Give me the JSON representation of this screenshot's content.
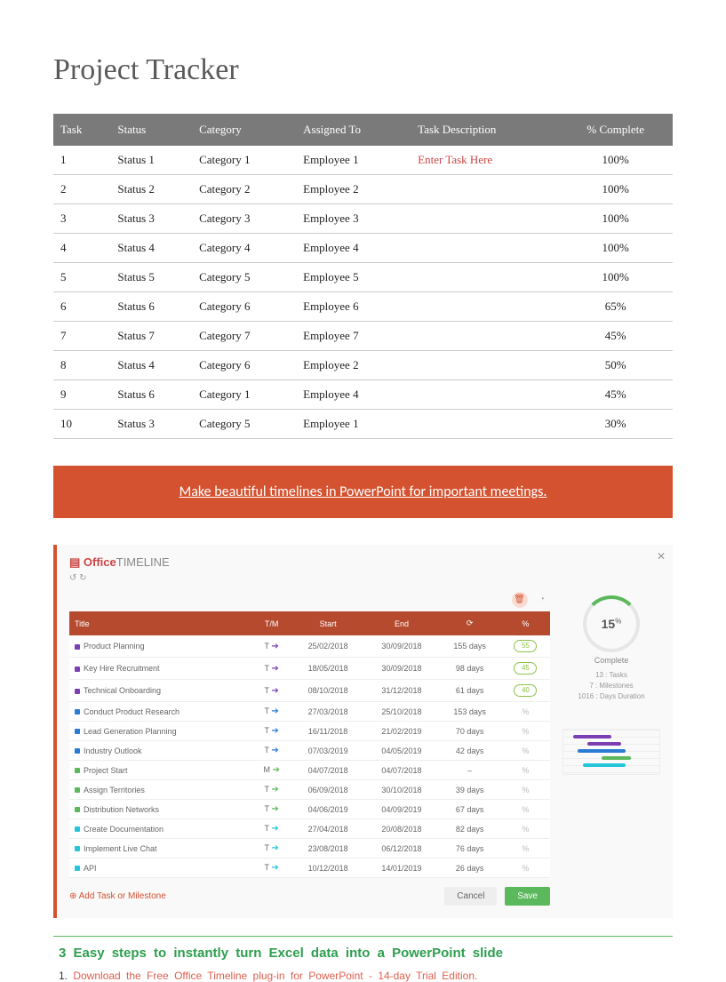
{
  "title": "Project Tracker",
  "table": {
    "headers": [
      "Task",
      "Status",
      "Category",
      "Assigned To",
      "Task Description",
      "% Complete"
    ],
    "rows": [
      {
        "task": "1",
        "status": "Status 1",
        "category": "Category 1",
        "assigned": "Employee 1",
        "desc": "Enter Task Here",
        "pct": "100%"
      },
      {
        "task": "2",
        "status": "Status 2",
        "category": "Category 2",
        "assigned": "Employee 2",
        "desc": "",
        "pct": "100%"
      },
      {
        "task": "3",
        "status": "Status 3",
        "category": "Category 3",
        "assigned": "Employee 3",
        "desc": "",
        "pct": "100%"
      },
      {
        "task": "4",
        "status": "Status 4",
        "category": "Category 4",
        "assigned": "Employee 4",
        "desc": "",
        "pct": "100%"
      },
      {
        "task": "5",
        "status": "Status 5",
        "category": "Category 5",
        "assigned": "Employee 5",
        "desc": "",
        "pct": "100%"
      },
      {
        "task": "6",
        "status": "Status 6",
        "category": "Category 6",
        "assigned": "Employee 6",
        "desc": "",
        "pct": "65%"
      },
      {
        "task": "7",
        "status": "Status 7",
        "category": "Category 7",
        "assigned": "Employee 7",
        "desc": "",
        "pct": "45%"
      },
      {
        "task": "8",
        "status": "Status 4",
        "category": "Category 6",
        "assigned": "Employee 2",
        "desc": "",
        "pct": "50%"
      },
      {
        "task": "9",
        "status": "Status 6",
        "category": "Category 1",
        "assigned": "Employee 4",
        "desc": "",
        "pct": "45%"
      },
      {
        "task": "10",
        "status": "Status 3",
        "category": "Category 5",
        "assigned": "Employee 1",
        "desc": "",
        "pct": "30%"
      }
    ]
  },
  "banner": "Make beautiful timelines in PowerPoint for important meetings.",
  "otl": {
    "brand1": "Office",
    "brand2": "TIMELINE",
    "headers": {
      "title": "Title",
      "tm": "T/M",
      "start": "Start",
      "end": "End",
      "dur": "⟳",
      "pct": "%"
    },
    "rows": [
      {
        "title": "Product Planning",
        "tm": "T",
        "color": "#7b3fb3",
        "start": "25/02/2018",
        "end": "30/09/2018",
        "dur": "155 days",
        "pct": "55"
      },
      {
        "title": "Key Hire Recruitment",
        "tm": "T",
        "color": "#7b3fb3",
        "start": "18/05/2018",
        "end": "30/09/2018",
        "dur": "98 days",
        "pct": "45"
      },
      {
        "title": "Technical Onboarding",
        "tm": "T",
        "color": "#7b3fb3",
        "start": "08/10/2018",
        "end": "31/12/2018",
        "dur": "61 days",
        "pct": "40"
      },
      {
        "title": "Conduct Product Research",
        "tm": "T",
        "color": "#2a7bd4",
        "start": "27/03/2018",
        "end": "25/10/2018",
        "dur": "153 days",
        "pct": ""
      },
      {
        "title": "Lead Generation Planning",
        "tm": "T",
        "color": "#2a7bd4",
        "start": "16/11/2018",
        "end": "21/02/2019",
        "dur": "70 days",
        "pct": ""
      },
      {
        "title": "Industry Outlook",
        "tm": "T",
        "color": "#2a7bd4",
        "start": "07/03/2019",
        "end": "04/05/2019",
        "dur": "42 days",
        "pct": ""
      },
      {
        "title": "Project Start",
        "tm": "M",
        "color": "#5cb85c",
        "start": "04/07/2018",
        "end": "04/07/2018",
        "dur": "–",
        "pct": ""
      },
      {
        "title": "Assign Territories",
        "tm": "T",
        "color": "#5cb85c",
        "start": "06/09/2018",
        "end": "30/10/2018",
        "dur": "39 days",
        "pct": ""
      },
      {
        "title": "Distribution Networks",
        "tm": "T",
        "color": "#5cb85c",
        "start": "04/06/2019",
        "end": "04/09/2019",
        "dur": "67 days",
        "pct": ""
      },
      {
        "title": "Create Documentation",
        "tm": "T",
        "color": "#26c6da",
        "start": "27/04/2018",
        "end": "20/08/2018",
        "dur": "82 days",
        "pct": ""
      },
      {
        "title": "Implement Live Chat",
        "tm": "T",
        "color": "#26c6da",
        "start": "23/08/2018",
        "end": "06/12/2018",
        "dur": "76 days",
        "pct": ""
      },
      {
        "title": "API",
        "tm": "T",
        "color": "#26c6da",
        "start": "10/12/2018",
        "end": "14/01/2019",
        "dur": "26 days",
        "pct": ""
      }
    ],
    "add": "Add Task or Milestone",
    "cancel": "Cancel",
    "save": "Save",
    "summary": {
      "pct": "15",
      "pctlabel": "Complete",
      "tasks": "13 : Tasks",
      "ms": "7 : Milestones",
      "dur": "1016 : Days Duration"
    }
  },
  "steps": {
    "title": "3 Easy steps to instantly turn Excel data into a PowerPoint slide",
    "line1_num": "1. ",
    "line1_text": "Download the Free Office Timeline plug-in for PowerPoint - 14-day Trial Edition."
  }
}
